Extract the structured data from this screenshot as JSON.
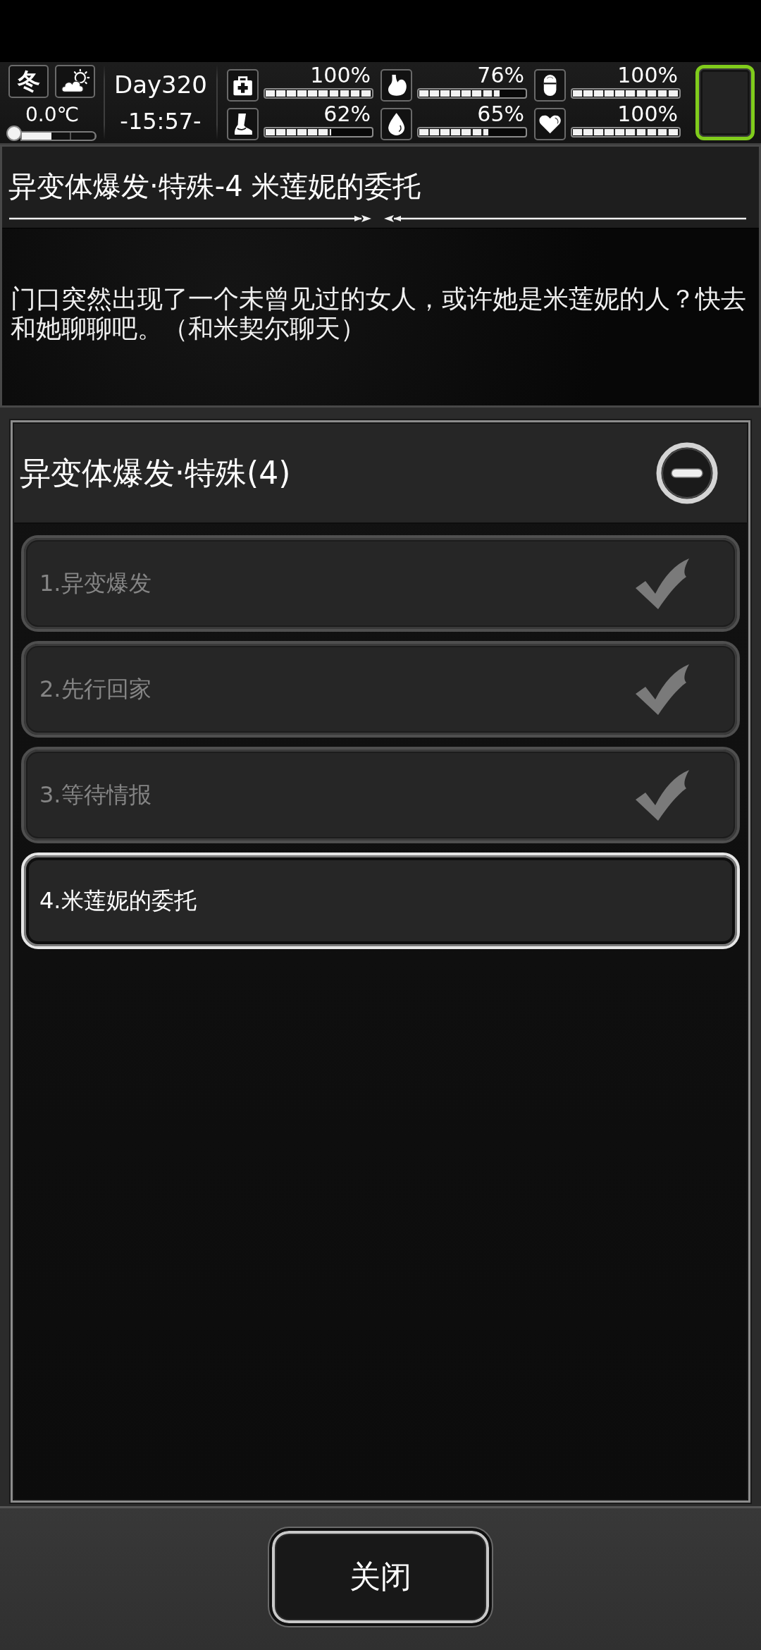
{
  "hud": {
    "season": "冬",
    "temperature": "0.0℃",
    "thermometer": {
      "level": 0.4
    },
    "day": "Day320",
    "time": "-15:57-",
    "stats": [
      {
        "kind": "medkit",
        "reading": "100%",
        "level": 1
      },
      {
        "kind": "stomach",
        "reading": "76%",
        "level": 0.76
      },
      {
        "kind": "capsule",
        "reading": "100%",
        "level": 1
      },
      {
        "kind": "foot",
        "reading": "62%",
        "level": 0.62
      },
      {
        "kind": "drop",
        "reading": "65%",
        "level": 0.65
      },
      {
        "kind": "heart",
        "reading": "100%",
        "level": 1
      }
    ]
  },
  "quest": {
    "title": "异变体爆发·特殊-4 米莲妮的委托",
    "description": "门口突然出现了一个未曾见过的女人，或许她是米莲妮的人？快去和她聊聊吧。（和米契尔聊天）"
  },
  "group": {
    "title": "异变体爆发·特殊(4)",
    "expanded": true,
    "steps": [
      {
        "label": "1.异变爆发",
        "completed": true
      },
      {
        "label": "2.先行回家",
        "completed": true
      },
      {
        "label": "3.等待情报",
        "completed": true
      },
      {
        "label": "4.米莲妮的委托",
        "completed": false
      }
    ]
  },
  "close_button": "关闭"
}
